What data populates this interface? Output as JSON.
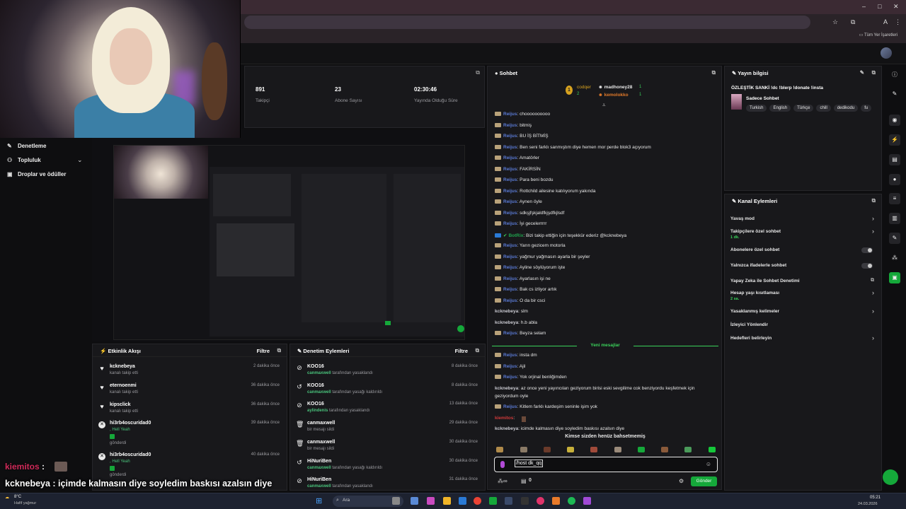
{
  "browser": {
    "bookmarks_label": "Tüm Yer İşaretleri",
    "window_controls": [
      "–",
      "□",
      "✕"
    ]
  },
  "leftnav": {
    "items": [
      {
        "label": "Denetleme",
        "icon": "wrench-icon"
      },
      {
        "label": "Topluluk",
        "icon": "people-icon"
      },
      {
        "label": "Droplar ve ödüller",
        "icon": "gift-icon"
      }
    ]
  },
  "stats": [
    {
      "value": "891",
      "label": "Takipçi"
    },
    {
      "value": "23",
      "label": "Abone Sayısı"
    },
    {
      "value": "02:30:46",
      "label": "Yayında Olduğu Süre"
    }
  ],
  "activity": {
    "title": "Etkinlik Akışı",
    "filter": "Filtre",
    "items": [
      {
        "name": "kcknebeya",
        "sub": "kanalı takip etti",
        "time": "2 dakika önce",
        "type": "heart"
      },
      {
        "name": "eternoenmi",
        "sub": "kanalı takip etti",
        "time": "36 dakika önce",
        "type": "heart"
      },
      {
        "name": "kipsclick",
        "sub": "kanalı takip etti",
        "time": "36 dakika önce",
        "type": "heart"
      },
      {
        "name": "hi3rb4oscuridad0",
        "sub": ", Hell Yeah",
        "sub2": "gönderdi",
        "time": "39 dakika önce",
        "type": "kick"
      },
      {
        "name": "hi3rb4oscuridad0",
        "sub": ", Hell Yeah",
        "sub2": "gönderdi",
        "time": "40 dakika önce",
        "type": "kick"
      }
    ]
  },
  "moderation": {
    "title": "Denetim Eylemleri",
    "filter": "Filtre",
    "items": [
      {
        "name": "KOO16",
        "by": "canmaxwell",
        "action": "tarafından yasaklandı",
        "time": "8 dakika önce",
        "type": "ban"
      },
      {
        "name": "KOO16",
        "by": "canmaxwell",
        "action": "tarafından yasağı kaldırıldı",
        "time": "8 dakika önce",
        "type": "undo"
      },
      {
        "name": "KOO16",
        "by": "aylindenis",
        "action": "tarafından yasaklandı",
        "time": "13 dakika önce",
        "type": "ban"
      },
      {
        "name": "canmaxwell",
        "by": "",
        "action": "bir mesajı sildi",
        "time": "29 dakika önce",
        "type": "delete"
      },
      {
        "name": "canmaxwell",
        "by": "",
        "action": "bir mesajı sildi",
        "time": "30 dakika önce",
        "type": "delete"
      },
      {
        "name": "HiNuriBen",
        "by": "canmaxwell",
        "action": "tarafından yasağı kaldırıldı",
        "time": "30 dakika önce",
        "type": "undo"
      },
      {
        "name": "HiNuriBen",
        "by": "canmaxwell",
        "action": "tarafından yasaklandı",
        "time": "31 dakika önce",
        "type": "ban"
      }
    ]
  },
  "chat": {
    "title": "Sohbet",
    "top_users": [
      {
        "name": "codqer",
        "count": "2"
      },
      {
        "name": "madhoney28",
        "count": "1"
      },
      {
        "name": "kemolokko",
        "count": "1"
      }
    ],
    "messages": [
      {
        "user": "Reijus",
        "text": ": choooooooooo",
        "style": "u"
      },
      {
        "user": "Reijus",
        "text": ": bitmiş",
        "style": "u"
      },
      {
        "user": "Reijus",
        "text": ": BU İŞ BİTMİŞ",
        "style": "u"
      },
      {
        "user": "Reijus",
        "text": ": Ben seni farklı sanmıştım diye hemen mor perde blok3 açıyorum",
        "style": "u"
      },
      {
        "user": "Reijus",
        "text": ": Amatörler",
        "style": "u"
      },
      {
        "user": "Reijus",
        "text": ": FAKİRSİN",
        "style": "u"
      },
      {
        "user": "Reijus",
        "text": ": Para beni bozdu",
        "style": "u"
      },
      {
        "user": "Reijus",
        "text": ": Rottchild ailesine katılıyorum yakında",
        "style": "u"
      },
      {
        "user": "Reijus",
        "text": ": Aynen öyle",
        "style": "u"
      },
      {
        "user": "Reijus",
        "text": ": sdkşjfşkjaldfkjşdfkjlsdf",
        "style": "u"
      },
      {
        "user": "Reijus",
        "text": ": İyi gecelerrrrr",
        "style": "u"
      },
      {
        "user": "BotRix",
        "text": ": Bizi takip ettiğin için teşekkür ederiz @kcknebeya",
        "style": "u"
      },
      {
        "user": "Reijus",
        "text": ": Yarın gezicem motorla",
        "style": "u"
      },
      {
        "user": "Reijus",
        "text": ": yağmur yağmasın ayarla bir şeyler",
        "style": "u"
      },
      {
        "user": "Reijus",
        "text": ": Ayline söylüyorum işte",
        "style": "u"
      },
      {
        "user": "Reijus",
        "text": ": Ayarlasın işi ne",
        "style": "u"
      },
      {
        "user": "Reijus",
        "text": ": Bak cs izliyor artık",
        "style": "u"
      },
      {
        "user": "Reijus",
        "text": ": O da bir csci",
        "style": "u"
      },
      {
        "user": "kcknebeya",
        "text": ": slm",
        "style": "u2"
      },
      {
        "user": "kcknebeya",
        "text": ": h.b abla",
        "style": "u2"
      },
      {
        "user": "Reijus",
        "text": ": Beyza selam",
        "style": "u"
      }
    ],
    "new_messages_label": "Yeni mesajlar",
    "new_messages": [
      {
        "user": "Reijus",
        "text": ": insta dm",
        "style": "u"
      },
      {
        "user": "Reijus",
        "text": ": Ajil",
        "style": "u"
      },
      {
        "user": "Reijus",
        "text": ": Yok orjinal benliğimden",
        "style": "u"
      },
      {
        "user": "kcknebeya",
        "text": ": az once yeni yayıncıları geziyorum birisi eski sevgilime cok benziyordu keşfetmek için",
        "style": "u2"
      },
      {
        "user": "",
        "text": "geziyordum oyle",
        "style": "u2"
      },
      {
        "user": "Reijus",
        "text": ": Kitlem farklı kardeşim seninle işim yok",
        "style": "u"
      },
      {
        "user": "kiemitos",
        "text": ":",
        "style": "u3"
      },
      {
        "user": "kcknebeya",
        "text": ": icimde kalmasın diye soyledim baskısı azalsın diye",
        "style": "u2"
      }
    ],
    "empty_note": "Kimse sizden henüz bahsetmemiş",
    "input_value": "/host dk_qq",
    "send_label": "Gönder",
    "viewer_count": "0"
  },
  "stream_info": {
    "title": "Yayın bilgisi",
    "stream_title": "ÖZLEŞTİK SANKİ !dc !blerp !donate !insta",
    "category": "Sadece Sohbet",
    "tags": [
      "Turkish",
      "English",
      "Türkçe",
      "chill",
      "dedikodu",
      "fu"
    ]
  },
  "channel_actions": {
    "title": "Kanal Eylemleri",
    "items": [
      {
        "label": "Yavaş mod",
        "sub": "",
        "control": "chevron"
      },
      {
        "label": "Takipçilere özel sohbet",
        "sub": "1 dk.",
        "control": "chevron"
      },
      {
        "label": "Abonelere özel sohbet",
        "sub": "",
        "control": "toggle"
      },
      {
        "label": "Yalnızca ifadelerle sohbet",
        "sub": "",
        "control": "toggle"
      },
      {
        "label": "Yapay Zeka ile Sohbet Denetimi",
        "sub": "",
        "control": "external"
      },
      {
        "label": "Hesap yaşı kısıtlaması",
        "sub": "2 sa.",
        "control": "chevron"
      },
      {
        "label": "Yasaklanmış kelimeler",
        "sub": "",
        "control": "chevron"
      },
      {
        "label": "İzleyici Yönlendir",
        "sub": "",
        "control": "none"
      },
      {
        "label": "Hedefleri belirleyin",
        "sub": "",
        "control": "chevron"
      }
    ]
  },
  "overlay": {
    "line1_user": "kiemitos",
    "line1_sep": " :",
    "line2_user": "kcknebeya",
    "line2_text": " : içimde kalmasın diye soyledim baskısı azalsın diye"
  },
  "taskbar": {
    "weather_temp": "8°C",
    "weather_desc": "Hafif yağmur",
    "search_placeholder": "Ara",
    "time": "05:21",
    "date": "24.03.2026"
  },
  "colors": {
    "accent": "#15a83a",
    "chat_user": "#5b7bd6",
    "background": "#0e0e10"
  }
}
